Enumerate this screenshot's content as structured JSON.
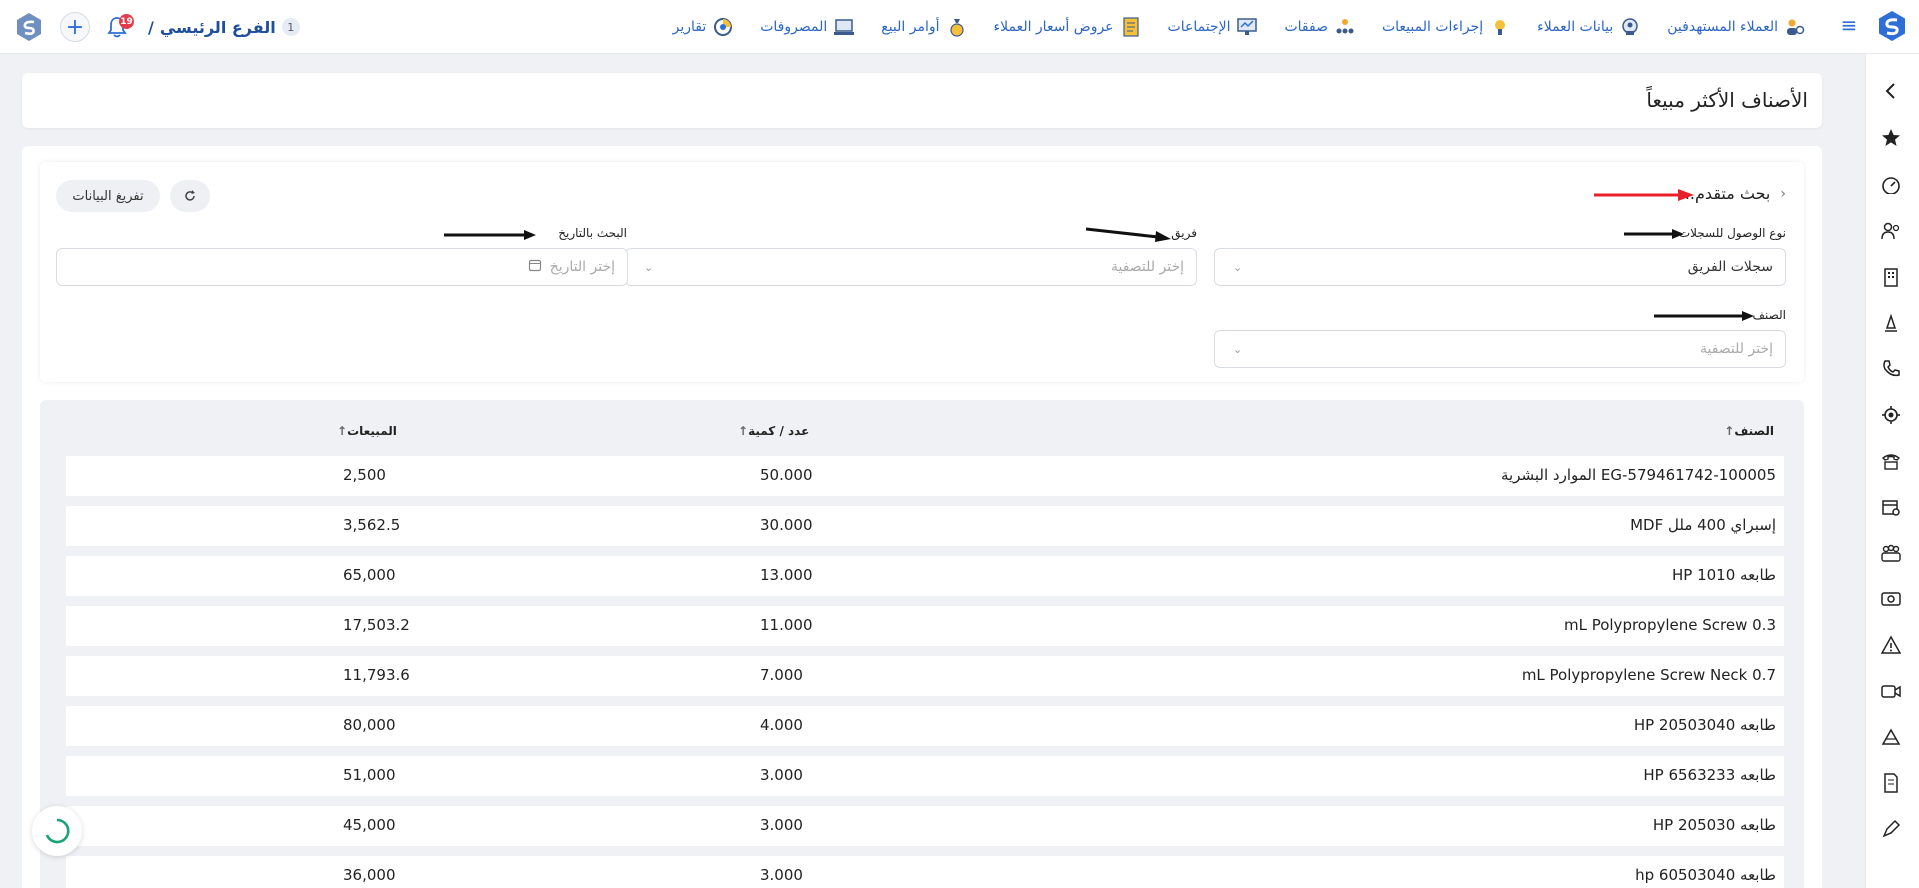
{
  "topbar": {
    "nav": [
      {
        "label": "العملاء المستهدفين",
        "icon": "target-customers-icon"
      },
      {
        "label": "بيانات العملاء",
        "icon": "customer-data-icon"
      },
      {
        "label": "إجراءات المبيعات",
        "icon": "sales-actions-icon"
      },
      {
        "label": "صفقات",
        "icon": "deals-icon"
      },
      {
        "label": "الإجتماعات",
        "icon": "meetings-icon"
      },
      {
        "label": "عروض أسعار العملاء",
        "icon": "quotes-icon"
      },
      {
        "label": "أوامر البيع",
        "icon": "sales-orders-icon"
      },
      {
        "label": "المصروفات",
        "icon": "expenses-icon"
      },
      {
        "label": "تقارير",
        "icon": "reports-icon"
      }
    ],
    "branch_number": "1",
    "branch_name": "الفرع الرئيسي",
    "branch_sep": "/",
    "notification_count": "19"
  },
  "page": {
    "title": "الأصناف الأكثر مبيعاً"
  },
  "filters": {
    "advanced_search": "بحث متقدم...",
    "clear_button": "تفريغ البيانات",
    "access_type_label": "نوع الوصول للسجلات",
    "access_type_value": "سجلات الفريق",
    "team_label": "فريق",
    "team_placeholder": "إختر للتصفية",
    "date_label": "البحث بالتاريخ",
    "date_placeholder": "إختر التاريخ",
    "item_label": "الصنف",
    "item_placeholder": "إختر للتصفية"
  },
  "table": {
    "headers": {
      "item": "الصنف",
      "qty": "عدد / كمية",
      "sales": "المبيعات"
    },
    "rows": [
      {
        "item": "EG-579461742-100005 الموارد البشرية",
        "qty": "50.000",
        "sales": "2,500"
      },
      {
        "item": "إسبراي 400 ملل MDF",
        "qty": "30.000",
        "sales": "3,562.5"
      },
      {
        "item": "طابعه HP 1010",
        "qty": "13.000",
        "sales": "65,000"
      },
      {
        "item": "mL Polypropylene Screw 0.3",
        "qty": "11.000",
        "sales": "17,503.2"
      },
      {
        "item": "mL Polypropylene Screw Neck 0.7",
        "qty": "7.000",
        "sales": "11,793.6"
      },
      {
        "item": "طابعه HP 20503040",
        "qty": "4.000",
        "sales": "80,000"
      },
      {
        "item": "طابعه HP 6563233",
        "qty": "3.000",
        "sales": "51,000"
      },
      {
        "item": "طابعه HP 205030",
        "qty": "3.000",
        "sales": "45,000"
      },
      {
        "item": "طابعه hp 60503040",
        "qty": "3.000",
        "sales": "36,000"
      }
    ]
  },
  "colors": {
    "accent": "#2d6fd6",
    "badge": "#e23b4a",
    "annotation_red": "#e8202a"
  }
}
